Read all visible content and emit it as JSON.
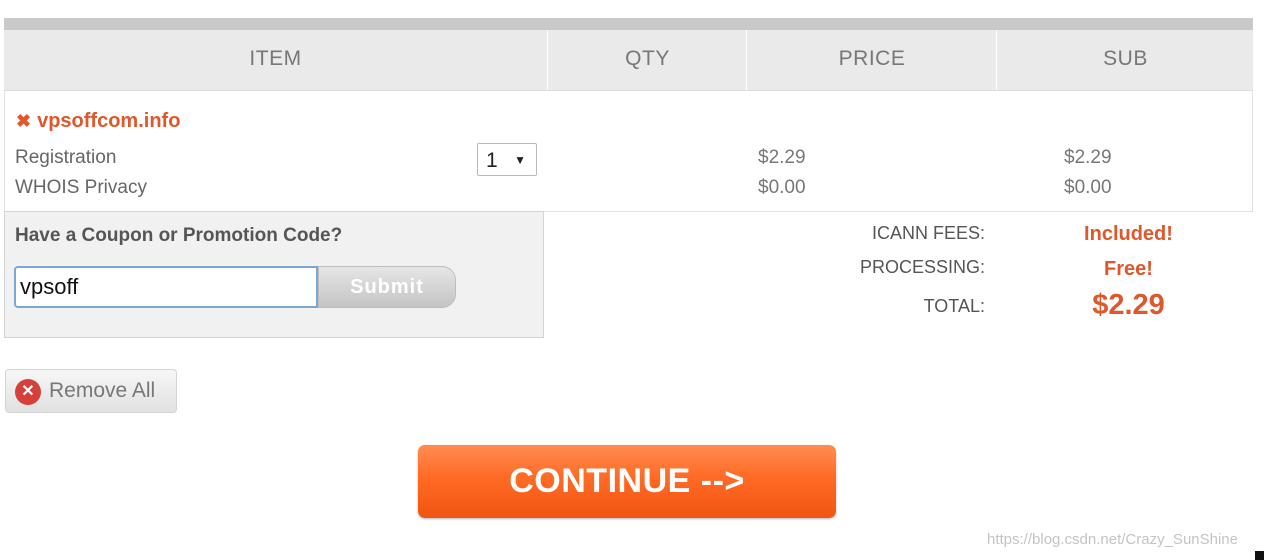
{
  "table": {
    "headers": [
      "ITEM",
      "QTY",
      "PRICE",
      "SUB"
    ]
  },
  "item": {
    "domain": "vpsoffcom.info",
    "remove_icon": "x-icon",
    "quantity": "1",
    "lines": [
      {
        "label": "Registration",
        "price": "$2.29",
        "sub": "$2.29"
      },
      {
        "label": "WHOIS Privacy",
        "price": "$0.00",
        "sub": "$0.00"
      }
    ]
  },
  "coupon": {
    "title": "Have a Coupon or Promotion Code?",
    "value": "vpsoff",
    "submit_label": "Submit"
  },
  "summary": {
    "icann_label": "ICANN FEES:",
    "icann_value": "Included!",
    "processing_label": "PROCESSING:",
    "processing_value": "Free!",
    "total_label": "TOTAL:",
    "total_value": "$2.29"
  },
  "actions": {
    "remove_all_label": "Remove All",
    "remove_icon": "remove-circle-icon",
    "continue_label": "CONTINUE -->"
  },
  "watermark": "https://blog.csdn.net/Crazy_SunShine",
  "colors": {
    "accent": "#e0572c",
    "continue": "#ff6a24"
  }
}
